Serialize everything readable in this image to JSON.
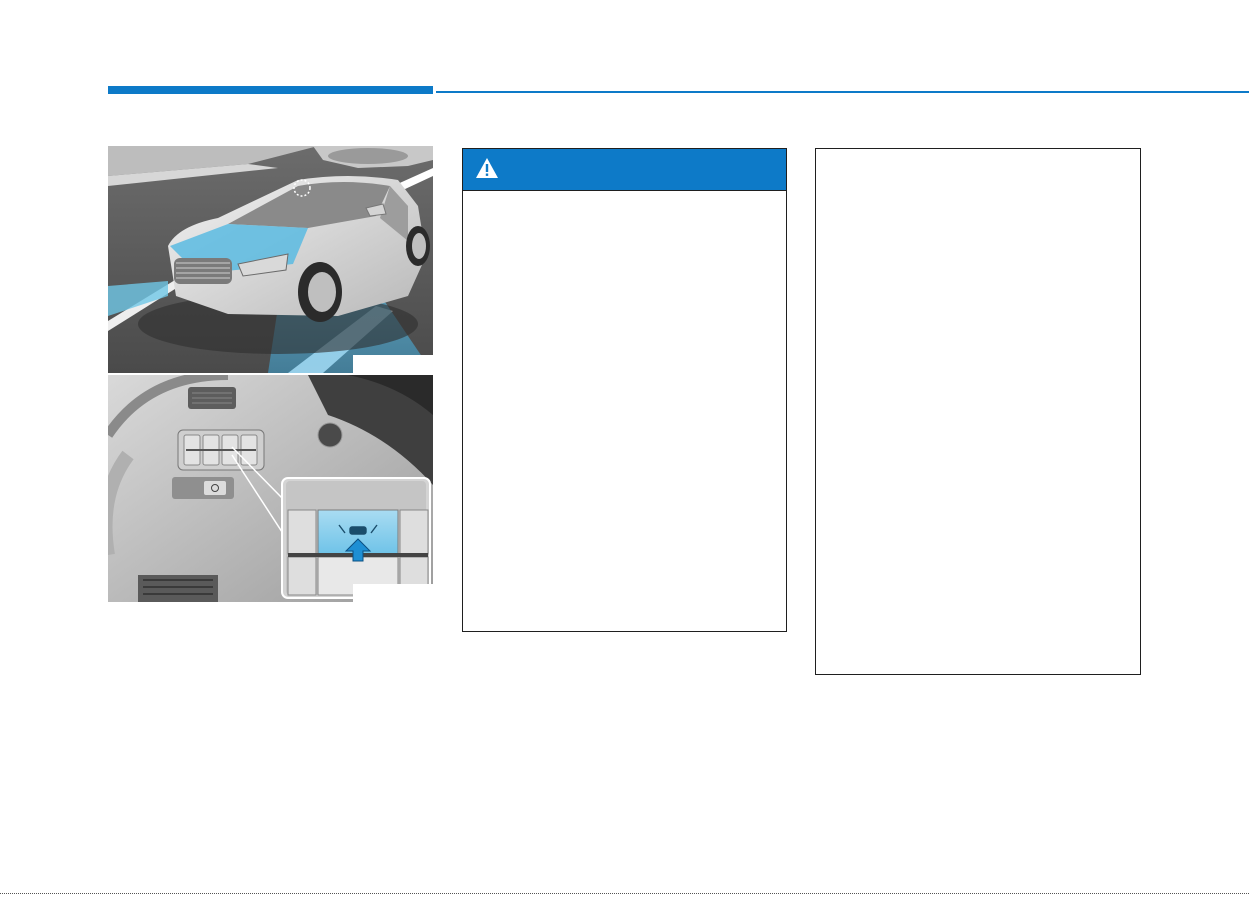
{
  "header": {
    "section_title": "",
    "accent_color": "#0d7ac8"
  },
  "figures": {
    "top": {
      "subject": "car-lane-camera-illustration",
      "code": ""
    },
    "bottom": {
      "subject": "dashboard-lkas-button-illustration",
      "code": ""
    }
  },
  "warning": {
    "icon": "warning-triangle-icon",
    "title": "",
    "body": "",
    "header_color": "#0d7ac8"
  },
  "info": {
    "body": ""
  }
}
